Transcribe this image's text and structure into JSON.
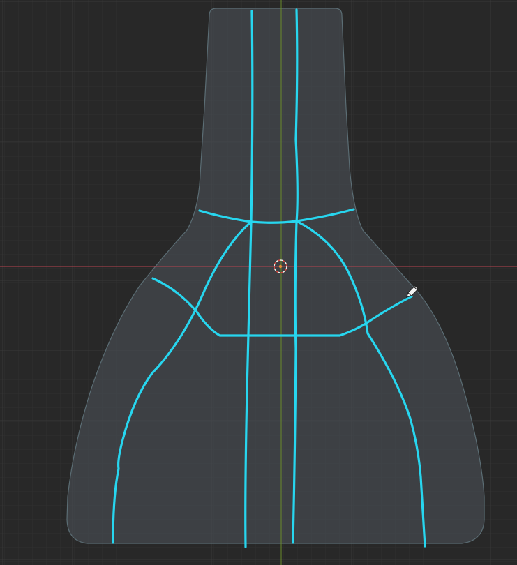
{
  "viewport": {
    "view": "orthographic-top",
    "background_color": "#282828",
    "grid": {
      "visible": true,
      "minor_color": "#303030",
      "major_color": "#393939"
    },
    "axes": {
      "x_axis_color": "#b8434f",
      "y_axis_color": "#6a8d2a"
    }
  },
  "mesh": {
    "shape": "bottle",
    "fill_color": "#4a4f56",
    "fill_opacity": 0.62,
    "outline_color": "#5b6d74"
  },
  "annotation": {
    "stroke_color": "#27d6ef",
    "stroke_count": 8
  },
  "cursor_3d": {
    "ring_color_primary": "#f0efe8",
    "ring_color_secondary": "#d6473f",
    "dot_color": "#e88a33"
  },
  "tool_cursor": {
    "icon": "annotate-pencil-icon",
    "color": "#f3f3f3"
  }
}
